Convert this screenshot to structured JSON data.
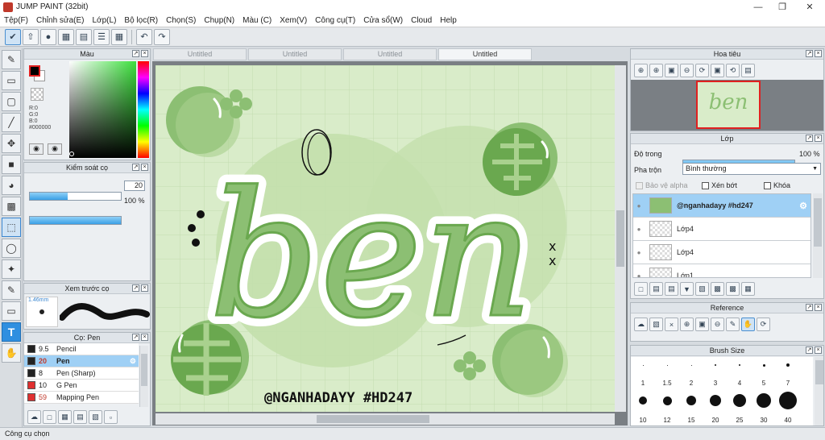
{
  "app": {
    "title": "JUMP PAINT (32bit)"
  },
  "menu": [
    "Tệp(F)",
    "Chỉnh sửa(E)",
    "Lớp(L)",
    "Bộ lọc(R)",
    "Chọn(S)",
    "Chụp(N)",
    "Màu (C)",
    "Xem(V)",
    "Công cụ(T)",
    "Cửa sổ(W)",
    "Cloud",
    "Help"
  ],
  "color_panel": {
    "title": "Màu",
    "r": "R:0",
    "g": "G:0",
    "b": "B:0",
    "hex": "#000000"
  },
  "brush_control": {
    "title": "Kiểm soát cọ",
    "size": "20",
    "opacity": "100 %",
    "size_fraction": 0.42,
    "opacity_fraction": 1.0
  },
  "brush_preview": {
    "title": "Xem trước cọ",
    "size_label": "1.46mm"
  },
  "brush_list": {
    "title": "Cọ: Pen",
    "items": [
      {
        "size": "9.5",
        "name": "Pencil",
        "color": "#222222",
        "selected": false
      },
      {
        "size": "20",
        "name": "Pen",
        "color": "#222222",
        "selected": true
      },
      {
        "size": "8",
        "name": "Pen (Sharp)",
        "color": "#222222",
        "selected": false
      },
      {
        "size": "10",
        "name": "G Pen",
        "color": "#e03030",
        "selected": false
      },
      {
        "size": "59",
        "name": "Mapping Pen",
        "color": "#e03030",
        "selected": false
      }
    ]
  },
  "tabs": [
    "Untitled",
    "Untitled",
    "Untitled",
    "Untitled"
  ],
  "canvas": {
    "main_word": "ben",
    "signature": "@NGANHADAYY #HD247",
    "bg": "#d9ecc9",
    "grid": "#c2dbb0",
    "green_dark": "#6aa84f",
    "green_mid": "#8cbf73",
    "green_light": "#a9d18e"
  },
  "navigator": {
    "title": "Hoa tiêu"
  },
  "layer_panel": {
    "title": "Lớp",
    "opacity_label": "Độ trong",
    "opacity_value": "100 %",
    "blend_label": "Pha trộn",
    "blend_value": "Bình thường",
    "protect_alpha": "Bảo vệ alpha",
    "clipping": "Xén bớt",
    "lock": "Khóa",
    "layers": [
      {
        "name": "@nganhadayy #hd247",
        "selected": true
      },
      {
        "name": "Lớp4",
        "selected": false
      },
      {
        "name": "Lớp4",
        "selected": false
      },
      {
        "name": "Lớp1",
        "selected": false
      }
    ]
  },
  "reference": {
    "title": "Reference"
  },
  "brush_size": {
    "title": "Brush Size",
    "row1": [
      "1",
      "1.5",
      "2",
      "3",
      "4",
      "5",
      "7"
    ],
    "row3": [
      "10",
      "12",
      "15",
      "20",
      "25",
      "30",
      "40"
    ]
  },
  "status": {
    "text": "Công cụ chọn"
  }
}
